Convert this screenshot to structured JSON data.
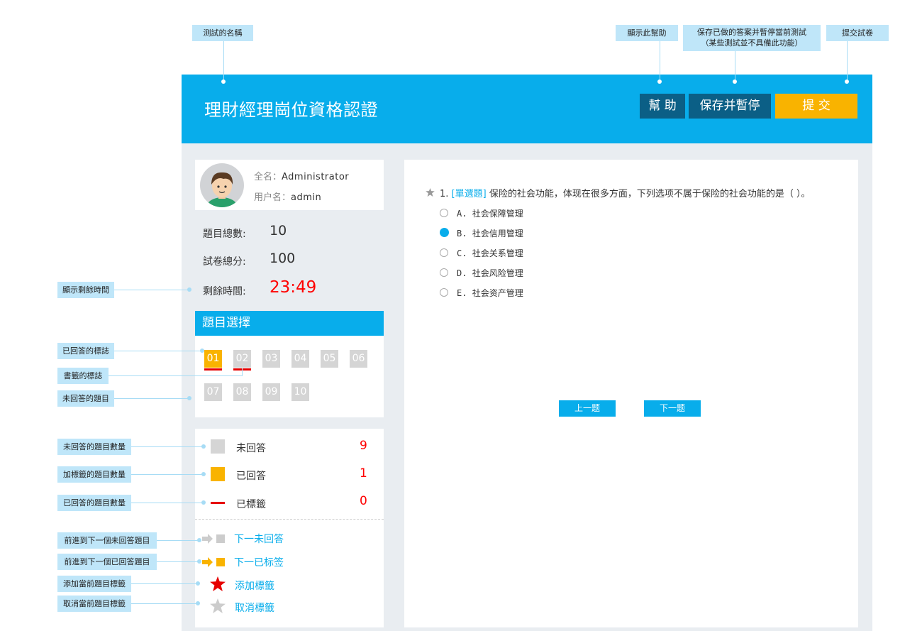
{
  "annotations": {
    "test_name": "测試的名稱",
    "show_help": "顯示此幫助",
    "save_pause_1": "保存已做的答案并暫停當前測試",
    "save_pause_2": "（某些測試並不具備此功能）",
    "submit_paper": "提交試卷",
    "show_remaining": "顯示剩餘時間",
    "answered_mark": "已回答的標誌",
    "bookmark_mark": "書籤的標誌",
    "unanswered_q": "未回答的題目",
    "unanswered_count": "未回答的題目數量",
    "bookmarked_count": "加標籤的題目數量",
    "answered_count": "已回答的題目數量",
    "goto_next_unanswered": "前進到下一個未回答題目",
    "goto_next_answered": "前進到下一個已回答題目",
    "add_bookmark": "添加當前題目標籤",
    "cancel_bookmark": "取消當前題目標籤"
  },
  "header": {
    "title": "理財經理崗位資格認證",
    "help_label": "幫 助",
    "save_label": "保存并暫停",
    "submit_label": "提 交"
  },
  "user": {
    "fullname_label": "全名：",
    "fullname": "Administrator",
    "username_label": "用户名：",
    "username": "admin"
  },
  "stats": {
    "total_label": "題目總數:",
    "total": "10",
    "score_label": "試卷總分:",
    "score": "100",
    "time_label": "剩餘時間:",
    "time": "23:49"
  },
  "question_select": {
    "title": "題目選擇",
    "numbers": [
      "01",
      "02",
      "03",
      "04",
      "05",
      "06",
      "07",
      "08",
      "09",
      "10"
    ]
  },
  "legend": {
    "unanswered_label": "未回答",
    "unanswered_count": "9",
    "answered_label": "已回答",
    "answered_count": "1",
    "bookmarked_label": "已標籤",
    "bookmarked_count": "0"
  },
  "nav": {
    "next_unanswered": "下一未回答",
    "next_bookmarked": "下一已标签",
    "add_bookmark": "添加標籤",
    "cancel_bookmark": "取消標籤"
  },
  "question": {
    "number": "1.",
    "type": "[單選題]",
    "text": "保险的社会功能，体现在很多方面，下列选项不属于保险的社会功能的是（ ）。",
    "options": [
      {
        "key": "A.",
        "text": "社会保障管理"
      },
      {
        "key": "B.",
        "text": "社会信用管理"
      },
      {
        "key": "C.",
        "text": "社会关系管理"
      },
      {
        "key": "D.",
        "text": "社会风险管理"
      },
      {
        "key": "E.",
        "text": "社会资产管理"
      }
    ],
    "selected": "B.",
    "prev_label": "上一题",
    "next_label": "下一题"
  },
  "colors": {
    "accent": "#08adeb",
    "submit": "#f9b300",
    "answered": "#f9b300",
    "unanswered": "#d5d5d5",
    "bookmark_line": "#e60000",
    "timer": "#ff0000"
  }
}
